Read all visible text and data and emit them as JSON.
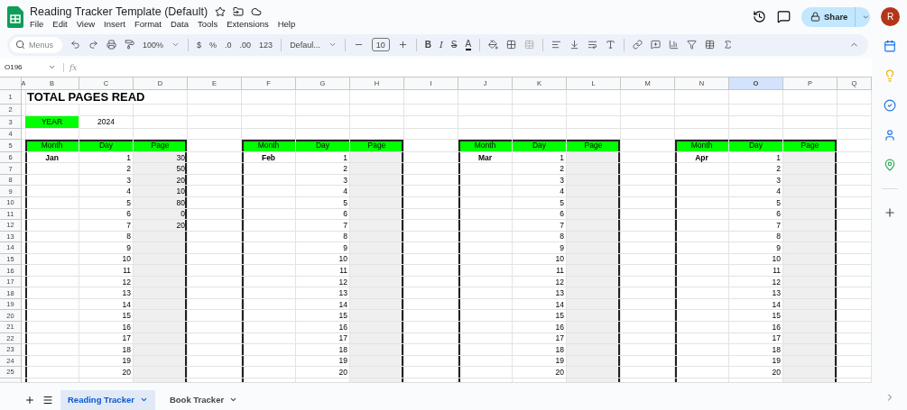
{
  "document": {
    "title": "Reading Tracker Template (Default)"
  },
  "menu": [
    "File",
    "Edit",
    "View",
    "Insert",
    "Format",
    "Data",
    "Tools",
    "Extensions",
    "Help"
  ],
  "share": {
    "label": "Share"
  },
  "account": {
    "initial": "R"
  },
  "toolbar": {
    "search_placeholder": "Menus",
    "zoom": "100%",
    "currency": "$",
    "percent": "%",
    "decrease_decimals": ".0",
    "increase_decimals": ".00",
    "number_format": "123",
    "font": "Defaul...",
    "font_size": "10",
    "bold": "B",
    "italic": "I",
    "strikethrough": "S",
    "text_color": "A"
  },
  "formula_bar": {
    "name_box": "O196",
    "fx": "fx"
  },
  "columns": [
    {
      "label": "A",
      "selected": false
    },
    {
      "label": "B",
      "selected": false
    },
    {
      "label": "C",
      "selected": false
    },
    {
      "label": "D",
      "selected": false
    },
    {
      "label": "E",
      "selected": false
    },
    {
      "label": "F",
      "selected": false
    },
    {
      "label": "G",
      "selected": false
    },
    {
      "label": "H",
      "selected": false
    },
    {
      "label": "I",
      "selected": false
    },
    {
      "label": "J",
      "selected": false
    },
    {
      "label": "K",
      "selected": false
    },
    {
      "label": "L",
      "selected": false
    },
    {
      "label": "M",
      "selected": false
    },
    {
      "label": "N",
      "selected": false
    },
    {
      "label": "O",
      "selected": true
    },
    {
      "label": "P",
      "selected": false
    },
    {
      "label": "Q",
      "selected": false
    }
  ],
  "rows": [
    "1",
    "2",
    "3",
    "4",
    "5",
    "6",
    "7",
    "8",
    "9",
    "10",
    "11",
    "12",
    "13",
    "14",
    "15",
    "16",
    "17",
    "18",
    "19",
    "20",
    "21",
    "22",
    "23",
    "24",
    "25"
  ],
  "title_cell": "TOTAL PAGES READ",
  "year": {
    "label": "YEAR",
    "value": "2024"
  },
  "trackers": [
    {
      "headers": [
        "Month",
        "Day",
        "Page"
      ],
      "month": "Jan",
      "days": [
        "1",
        "2",
        "3",
        "4",
        "5",
        "6",
        "7",
        "8",
        "9",
        "10",
        "11",
        "12",
        "13",
        "14",
        "15",
        "16",
        "17",
        "18",
        "19",
        "20"
      ],
      "pages": [
        "30",
        "50",
        "20",
        "10",
        "80",
        "0",
        "20"
      ]
    },
    {
      "headers": [
        "Month",
        "Day",
        "Page"
      ],
      "month": "Feb",
      "days": [
        "1",
        "2",
        "3",
        "4",
        "5",
        "6",
        "7",
        "8",
        "9",
        "10",
        "11",
        "12",
        "13",
        "14",
        "15",
        "16",
        "17",
        "18",
        "19",
        "20"
      ]
    },
    {
      "headers": [
        "Month",
        "Day",
        "Page"
      ],
      "month": "Mar",
      "days": [
        "1",
        "2",
        "3",
        "4",
        "5",
        "6",
        "7",
        "8",
        "9",
        "10",
        "11",
        "12",
        "13",
        "14",
        "15",
        "16",
        "17",
        "18",
        "19",
        "20"
      ]
    },
    {
      "headers": [
        "Month",
        "Day",
        "Page"
      ],
      "month": "Apr",
      "days": [
        "1",
        "2",
        "3",
        "4",
        "5",
        "6",
        "7",
        "8",
        "9",
        "10",
        "11",
        "12",
        "13",
        "14",
        "15",
        "16",
        "17",
        "18",
        "19",
        "20"
      ]
    }
  ],
  "sheets": [
    {
      "label": "Reading Tracker",
      "selected": true
    },
    {
      "label": "Book Tracker",
      "selected": false
    }
  ]
}
